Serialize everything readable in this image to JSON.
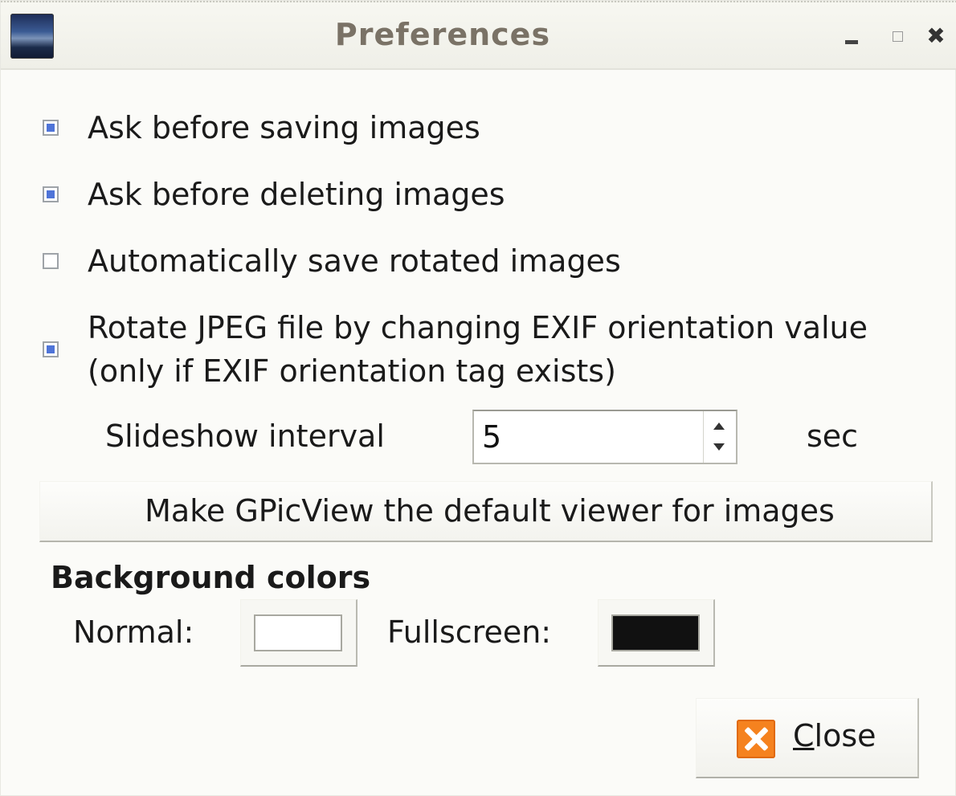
{
  "window": {
    "title": "Preferences",
    "app_icon": "gpicview-icon",
    "controls": {
      "minimize": "minimize",
      "maximize": "maximize",
      "close_glyph": "✖"
    }
  },
  "options": [
    {
      "label": "Ask before saving images",
      "checked": true
    },
    {
      "label": "Ask before deleting images",
      "checked": true
    },
    {
      "label": "Automatically save rotated images",
      "checked": false
    },
    {
      "label_line1": "Rotate JPEG file by changing EXIF orientation value",
      "label_line2": "(only if EXIF orientation tag exists)",
      "checked": true
    }
  ],
  "slideshow": {
    "label": "Slideshow interval",
    "value": "5",
    "unit": "sec"
  },
  "default_viewer_button": "Make GPicView the default viewer for images",
  "background_colors": {
    "heading": "Background colors",
    "normal_label": "Normal:",
    "normal_color": "#ffffff",
    "fullscreen_label": "Fullscreen:",
    "fullscreen_color": "#111111"
  },
  "close_button": {
    "mnemonic": "C",
    "rest": "lose",
    "icon": "close-x-icon"
  },
  "colors": {
    "checkbox_accent": "#4f74d8",
    "close_icon": "#f5821f"
  }
}
